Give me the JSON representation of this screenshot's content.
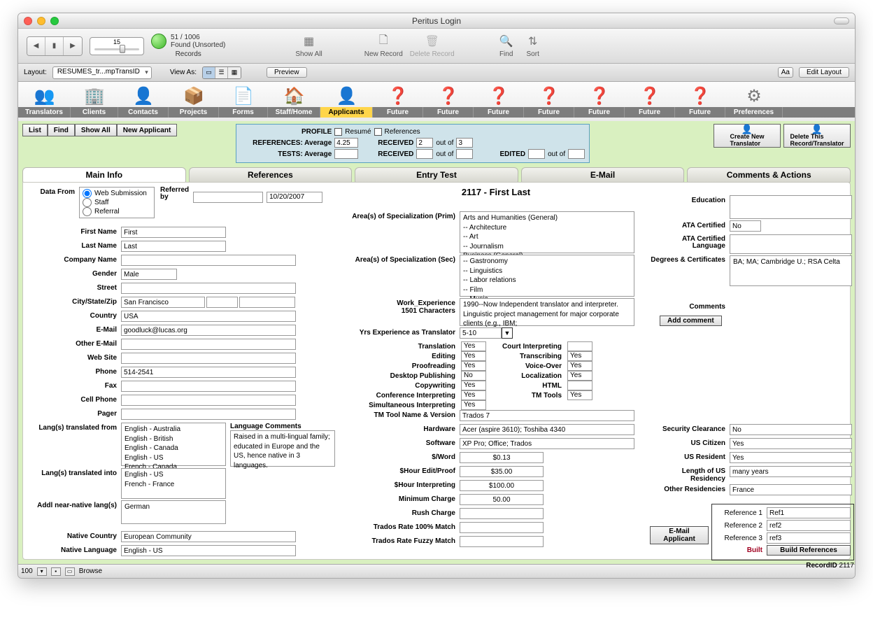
{
  "window": {
    "title": "Peritus Login"
  },
  "toolbar1": {
    "slider_value": "15",
    "found": "51 / 1006",
    "found_sub": "Found (Unsorted)",
    "records": "Records",
    "show_all": "Show All",
    "new_record": "New Record",
    "delete_record": "Delete Record",
    "find": "Find",
    "sort": "Sort"
  },
  "toolbar2": {
    "layout_label": "Layout:",
    "layout_value": "RESUMES_tr...mpTransID",
    "view_as": "View As:",
    "preview": "Preview",
    "edit_layout": "Edit Layout"
  },
  "iconbar": {
    "labels": [
      "Translators",
      "Clients",
      "Contacts",
      "Projects",
      "Forms",
      "Staff/Home",
      "Applicants",
      "Future",
      "Future",
      "Future",
      "Future",
      "Future",
      "Future",
      "Future",
      "Preferences"
    ]
  },
  "left_btns": {
    "list": "List",
    "find": "Find",
    "show_all": "Show All",
    "new_applicant": "New Applicant"
  },
  "profile": {
    "title": "PROFILE",
    "resume": "Resumé",
    "references": "References",
    "ref_avg_label": "REFERENCES: Average",
    "ref_avg": "4.25",
    "tests_avg_label": "TESTS: Average",
    "tests_avg": "",
    "received_label": "RECEIVED",
    "received1": "2",
    "out_of": "out of",
    "received1_total": "3",
    "received2": "",
    "received2_total": "",
    "edited_label": "EDITED",
    "edited": "",
    "edited_total": ""
  },
  "actions": {
    "create": "Create New\nTranslator",
    "delete": "Delete This\nRecord/Translator"
  },
  "tabs": [
    "Main Info",
    "References",
    "Entry Test",
    "E-Mail",
    "Comments & Actions"
  ],
  "record_title": "2117 - First Last",
  "main": {
    "labels": {
      "data_from": "Data From",
      "referred_by": "Referred by",
      "ref_date": "10/20/2007",
      "web": "Web Submission",
      "staff": "Staff",
      "referral": "Referral",
      "first_name": "First Name",
      "last_name": "Last Name",
      "company": "Company Name",
      "gender": "Gender",
      "street": "Street",
      "csz": "City/State/Zip",
      "country": "Country",
      "email": "E-Mail",
      "other_email": "Other E-Mail",
      "website": "Web Site",
      "phone": "Phone",
      "fax": "Fax",
      "cell": "Cell Phone",
      "pager": "Pager",
      "langs_from": "Lang(s) translated from",
      "langs_into": "Lang(s) translated into",
      "addl": "Addl near-native lang(s)",
      "lang_comments": "Language Comments",
      "native_country": "Native Country",
      "native_language": "Native Language"
    },
    "values": {
      "first_name": "First",
      "last_name": "Last",
      "gender": "Male",
      "city": "San Francisco",
      "country": "USA",
      "email": "goodluck@lucas.org",
      "phone": "514-2541",
      "langs_from": "English - Australia\nEnglish - British\nEnglish - Canada\nEnglish - US\nFrench - Canada",
      "langs_into": "English - US\nFrench - France",
      "addl": "German",
      "lang_comments": "Raised in a multi-lingual family; educated in Europe and the US, hence native in 3 languages.",
      "native_country": "European Community",
      "native_language": "English - US"
    }
  },
  "spec": {
    "prim_label": "Area(s) of Specialization (Prim)",
    "prim": "Arts and Humanities (General)\n-- Architecture\n-- Art\n-- Journalism\nBusiness (General)",
    "sec_label": "Area(s) of Specialization (Sec)",
    "sec": "-- Gastronomy\n-- Linguistics\n-- Labor relations\n-- Film\n-- Music",
    "work_label": "Work_Experience",
    "work_chars": "1501 Characters",
    "work": "1990--Now   Independent translator and interpreter. Linguistic project management for major corporate clients (e.g., IBM;",
    "yrs_label": "Yrs Experience as Translator",
    "yrs": "5-10"
  },
  "skills": {
    "translation_l": "Translation",
    "translation": "Yes",
    "editing_l": "Editing",
    "editing": "Yes",
    "proof_l": "Proofreading",
    "proof": "Yes",
    "dtp_l": "Desktop Publishing",
    "dtp": "No",
    "copy_l": "Copywriting",
    "copy": "Yes",
    "conf_l": "Conference Interpreting",
    "conf": "Yes",
    "simul_l": "Simultaneous Interpreting",
    "simul": "Yes",
    "court_l": "Court Interpreting",
    "court": "",
    "trans_l": "Transcribing",
    "trans": "Yes",
    "vo_l": "Voice-Over",
    "vo": "Yes",
    "loc_l": "Localization",
    "loc": "Yes",
    "html_l": "HTML",
    "html": "",
    "tmt_l": "TM Tools",
    "tmt": "Yes",
    "tmname_l": "TM Tool Name & Version",
    "tmname": "Trados 7",
    "hw_l": "Hardware",
    "hw": "Acer (aspire 3610); Toshiba 4340",
    "sw_l": "Software",
    "sw": "XP Pro; Office; Trados",
    "word_l": "$/Word",
    "word": "$0.13",
    "hredit_l": "$Hour Edit/Proof",
    "hredit": "$35.00",
    "hrint_l": "$Hour Interpreting",
    "hrint": "$100.00",
    "min_l": "Minimum Charge",
    "min": "50.00",
    "rush_l": "Rush Charge",
    "rush": "",
    "tr100_l": "Trados Rate 100% Match",
    "tr100": "",
    "trfuz_l": "Trados Rate Fuzzy Match",
    "trfuz": ""
  },
  "right": {
    "education_l": "Education",
    "ata_cert_l": "ATA Certified",
    "ata_cert": "No",
    "ata_lang_l": "ATA Certified Language",
    "degrees_l": "Degrees & Certificates",
    "degrees": "BA; MA; Cambridge U.; RSA Celta",
    "comments_l": "Comments",
    "add_comment": "Add comment",
    "sec_clear_l": "Security Clearance",
    "sec_clear": "No",
    "us_cit_l": "US Citizen",
    "us_cit": "Yes",
    "us_res_l": "US Resident",
    "us_res": "Yes",
    "len_res_l": "Length of US Residency",
    "len_res": "many years",
    "other_res_l": "Other Residencies",
    "other_res": "France",
    "ref1_l": "Reference 1",
    "ref1": "Ref1",
    "ref2_l": "Reference 2",
    "ref2": "ref2",
    "ref3_l": "Reference 3",
    "ref3": "ref3",
    "built": "Built",
    "build_refs": "Build References",
    "email_applicant": "E-Mail Applicant",
    "recordid_l": "RecordID",
    "recordid": "2117"
  },
  "footer": {
    "zoom": "100",
    "mode": "Browse"
  }
}
